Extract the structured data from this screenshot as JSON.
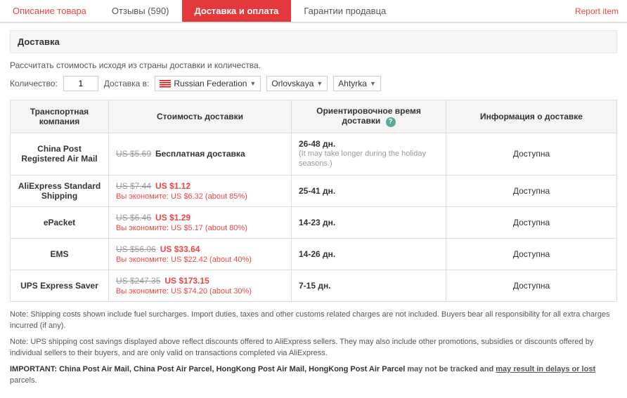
{
  "tabs": [
    {
      "id": "description",
      "label": "Описание товара",
      "active": false
    },
    {
      "id": "reviews",
      "label": "Отзывы (590)",
      "active": false
    },
    {
      "id": "delivery",
      "label": "Доставка и оплата",
      "active": true
    },
    {
      "id": "guarantee",
      "label": "Гарантии продавца",
      "active": false
    }
  ],
  "report_item": "Report item",
  "section": {
    "title": "Доставка",
    "calc_label": "Рассчитать стоимость исходя из страны доставки и количества.",
    "qty_label": "Количество:",
    "qty_value": "1",
    "dest_label": "Доставка в:",
    "country": "Russian Federation",
    "region": "Orlovskaya",
    "city": "Ahtyrka"
  },
  "table": {
    "headers": [
      "Транспортная компания",
      "Стоимость доставки",
      "Ориентировочное время доставки",
      "Информация о доставке"
    ],
    "rows": [
      {
        "carrier": "China Post Registered Air Mail",
        "price_old": "US $5.69",
        "price_new": "",
        "price_free": "Бесплатная доставка",
        "save_text": "",
        "time_main": "26-48 дн.",
        "time_note": "(It may take longer during the holiday seasons.)",
        "availability": "Доступна"
      },
      {
        "carrier": "AliExpress Standard Shipping",
        "price_old": "US $7.44",
        "price_new": "US $1.12",
        "price_free": "",
        "save_text": "Вы экономите: US $6.32 (about 85%)",
        "time_main": "25-41 дн.",
        "time_note": "",
        "availability": "Доступна"
      },
      {
        "carrier": "ePacket",
        "price_old": "US $6.46",
        "price_new": "US $1.29",
        "price_free": "",
        "save_text": "Вы экономите: US $5.17 (about 80%)",
        "time_main": "14-23 дн.",
        "time_note": "",
        "availability": "Доступна"
      },
      {
        "carrier": "EMS",
        "price_old": "US $56.06",
        "price_new": "US $33.64",
        "price_free": "",
        "save_text": "Вы экономите: US $22.42 (about 40%)",
        "time_main": "14-26 дн.",
        "time_note": "",
        "availability": "Доступна"
      },
      {
        "carrier": "UPS Express Saver",
        "price_old": "US $247.35",
        "price_new": "US $173.15",
        "price_free": "",
        "save_text": "Вы экономите: US $74.20 (about 30%)",
        "time_main": "7-15 дн.",
        "time_note": "",
        "availability": "Доступна"
      }
    ]
  },
  "notes": {
    "note1": "Note: Shipping costs shown include fuel surcharges. Import duties, taxes and other customs related charges are not included. Buyers bear all responsibility for all extra charges incurred (if any).",
    "note2": "Note: UPS shipping cost savings displayed above reflect discounts offered to AliExpress sellers. They may also include other promotions, subsidies or discounts offered by individual sellers to their buyers, and are only valid on transactions completed via AliExpress.",
    "note3_prefix": "IMPORTANT: China Post Air Mail, China Post Air Parcel, HongKong Post Air Mail, HongKong Post Air Parcel",
    "note3_bold": " may not be tracked and ",
    "note3_bold2": "may result in delays or lost",
    "note3_suffix": " parcels."
  }
}
